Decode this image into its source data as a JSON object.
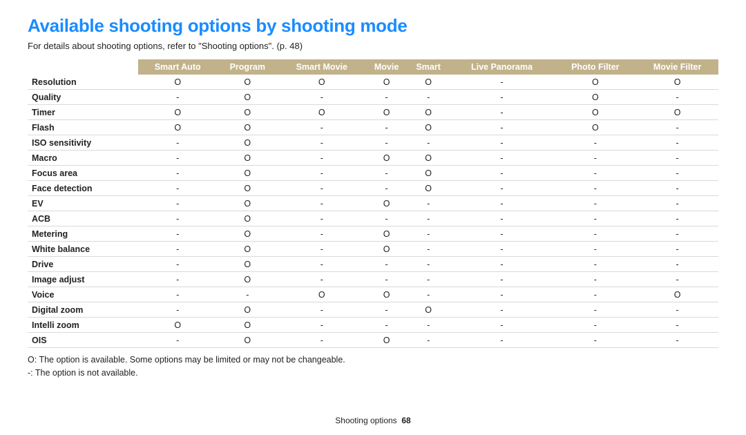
{
  "title": "Available shooting options by shooting mode",
  "subtitle": "For details about shooting options, refer to \"Shooting options\". (p. 48)",
  "columns": [
    "",
    "Smart Auto",
    "Program",
    "Smart Movie",
    "Movie",
    "Smart",
    "Live Panorama",
    "Photo Filter",
    "Movie Filter"
  ],
  "rows": [
    {
      "label": "Resolution",
      "cells": [
        "O",
        "O",
        "O",
        "O",
        "O",
        "-",
        "O",
        "O"
      ]
    },
    {
      "label": "Quality",
      "cells": [
        "-",
        "O",
        "-",
        "-",
        "-",
        "-",
        "O",
        "-"
      ]
    },
    {
      "label": "Timer",
      "cells": [
        "O",
        "O",
        "O",
        "O",
        "O",
        "-",
        "O",
        "O"
      ]
    },
    {
      "label": "Flash",
      "cells": [
        "O",
        "O",
        "-",
        "-",
        "O",
        "-",
        "O",
        "-"
      ]
    },
    {
      "label": "ISO sensitivity",
      "cells": [
        "-",
        "O",
        "-",
        "-",
        "-",
        "-",
        "-",
        "-"
      ]
    },
    {
      "label": "Macro",
      "cells": [
        "-",
        "O",
        "-",
        "O",
        "O",
        "-",
        "-",
        "-"
      ]
    },
    {
      "label": "Focus area",
      "cells": [
        "-",
        "O",
        "-",
        "-",
        "O",
        "-",
        "-",
        "-"
      ]
    },
    {
      "label": "Face detection",
      "cells": [
        "-",
        "O",
        "-",
        "-",
        "O",
        "-",
        "-",
        "-"
      ]
    },
    {
      "label": "EV",
      "cells": [
        "-",
        "O",
        "-",
        "O",
        "-",
        "-",
        "-",
        "-"
      ]
    },
    {
      "label": "ACB",
      "cells": [
        "-",
        "O",
        "-",
        "-",
        "-",
        "-",
        "-",
        "-"
      ]
    },
    {
      "label": "Metering",
      "cells": [
        "-",
        "O",
        "-",
        "O",
        "-",
        "-",
        "-",
        "-"
      ]
    },
    {
      "label": "White balance",
      "cells": [
        "-",
        "O",
        "-",
        "O",
        "-",
        "-",
        "-",
        "-"
      ]
    },
    {
      "label": "Drive",
      "cells": [
        "-",
        "O",
        "-",
        "-",
        "-",
        "-",
        "-",
        "-"
      ]
    },
    {
      "label": "Image adjust",
      "cells": [
        "-",
        "O",
        "-",
        "-",
        "-",
        "-",
        "-",
        "-"
      ]
    },
    {
      "label": "Voice",
      "cells": [
        "-",
        "-",
        "O",
        "O",
        "-",
        "-",
        "-",
        "O"
      ]
    },
    {
      "label": "Digital zoom",
      "cells": [
        "-",
        "O",
        "-",
        "-",
        "O",
        "-",
        "-",
        "-"
      ]
    },
    {
      "label": "Intelli zoom",
      "cells": [
        "O",
        "O",
        "-",
        "-",
        "-",
        "-",
        "-",
        "-"
      ]
    },
    {
      "label": "OIS",
      "cells": [
        "-",
        "O",
        "-",
        "O",
        "-",
        "-",
        "-",
        "-"
      ]
    }
  ],
  "legend1": "O: The option is available. Some options may be limited or may not be changeable.",
  "legend2": "-: The option is not available.",
  "footer_section": "Shooting options",
  "footer_page": "68"
}
